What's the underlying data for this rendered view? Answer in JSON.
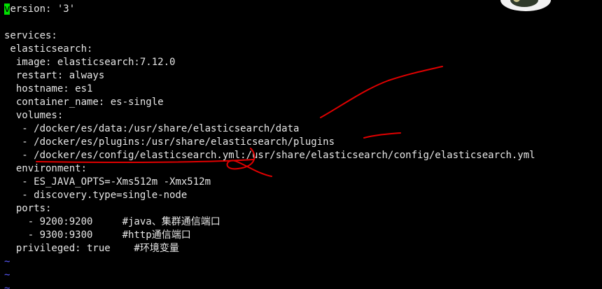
{
  "editor": {
    "cursor_char": "v",
    "lines": [
      {
        "text": "ersion: '3'"
      },
      {
        "text": ""
      },
      {
        "text": "services:"
      },
      {
        "text": " elasticsearch:"
      },
      {
        "text": "  image: elasticsearch:7.12.0"
      },
      {
        "text": "  restart: always"
      },
      {
        "text": "  hostname: es1"
      },
      {
        "text": "  container_name: es-single"
      },
      {
        "text": "  volumes:"
      },
      {
        "text": "   - /docker/es/data:/usr/share/elasticsearch/data"
      },
      {
        "text": "   - /docker/es/plugins:/usr/share/elasticsearch/plugins"
      },
      {
        "text": "   - /docker/es/config/elasticsearch.yml:/usr/share/elasticsearch/config/elasticsearch.yml"
      },
      {
        "text": "  environment:"
      },
      {
        "text": "   - ES_JAVA_OPTS=-Xms512m -Xmx512m"
      },
      {
        "text": "   - discovery.type=single-node"
      },
      {
        "text": "  ports:"
      },
      {
        "text": "    - 9200:9200     #java、集群通信端口"
      },
      {
        "text": "    - 9300:9300     #http通信端口"
      },
      {
        "text": "  privileged: true    #环境变量"
      }
    ],
    "empty_line_markers": [
      "~",
      "~",
      "~"
    ]
  },
  "colors": {
    "background": "#000000",
    "text": "#e6e6e6",
    "cursor": "#00e000",
    "tilde": "#5a5aff",
    "annotation": "#e00000"
  }
}
